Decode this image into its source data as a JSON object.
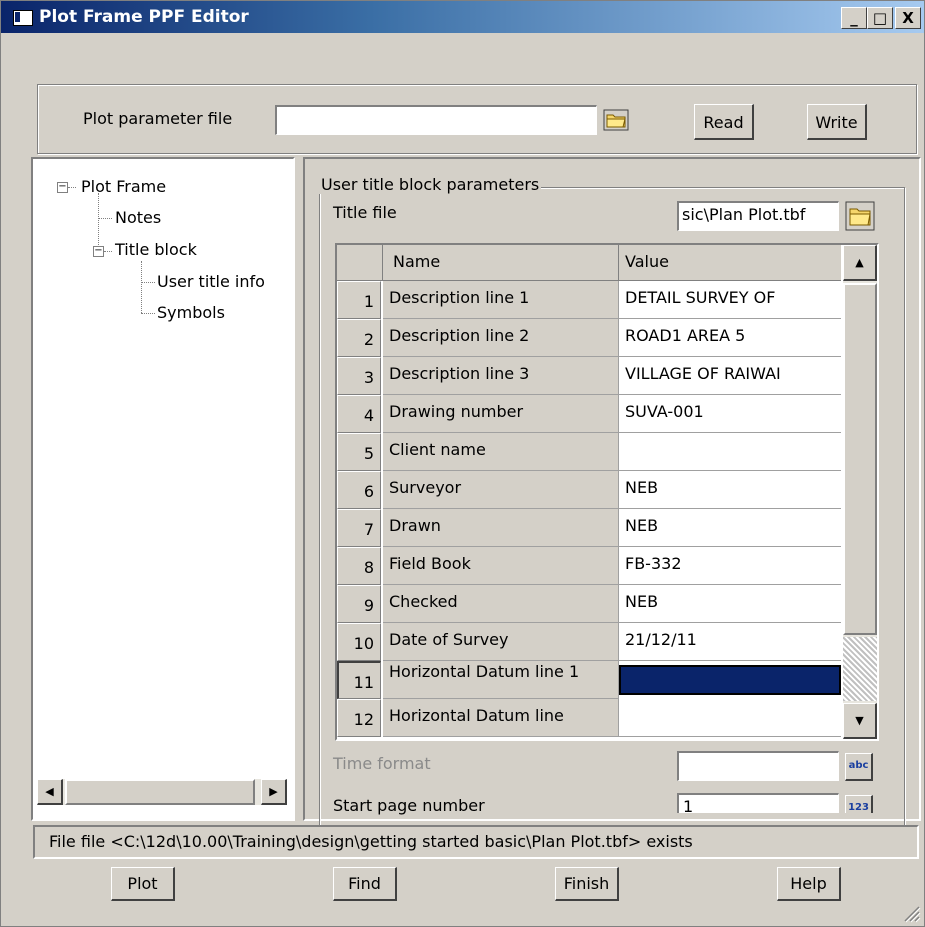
{
  "window": {
    "title": "Plot Frame PPF Editor",
    "controls": {
      "minimize": "_",
      "maximize": "□",
      "close": "X"
    }
  },
  "top": {
    "ppf_label": "Plot parameter file",
    "ppf_value": "",
    "read_label": "Read",
    "write_label": "Write"
  },
  "tree": {
    "items": [
      {
        "label": "Plot Frame",
        "expander": "−"
      },
      {
        "label": "Notes"
      },
      {
        "label": "Title block",
        "expander": "−"
      },
      {
        "label": "User title info"
      },
      {
        "label": "Symbols"
      }
    ]
  },
  "panel": {
    "group_label": "User title block parameters",
    "title_file_label": "Title file",
    "title_file_value": "sic\\Plan Plot.tbf",
    "grid": {
      "headers": [
        "Name",
        "Value"
      ],
      "rows": [
        {
          "num": "1",
          "name": "Description line 1",
          "value": "DETAIL SURVEY OF"
        },
        {
          "num": "2",
          "name": "Description line 2",
          "value": "ROAD1 AREA 5"
        },
        {
          "num": "3",
          "name": "Description line 3",
          "value": "VILLAGE OF RAIWAI"
        },
        {
          "num": "4",
          "name": "Drawing number",
          "value": "SUVA-001"
        },
        {
          "num": "5",
          "name": "Client name",
          "value": ""
        },
        {
          "num": "6",
          "name": "Surveyor",
          "value": "NEB"
        },
        {
          "num": "7",
          "name": "Drawn",
          "value": "NEB"
        },
        {
          "num": "8",
          "name": "Field Book",
          "value": "FB-332"
        },
        {
          "num": "9",
          "name": "Checked",
          "value": "NEB"
        },
        {
          "num": "10",
          "name": "Date of Survey",
          "value": "21/12/11"
        },
        {
          "num": "11",
          "name": "Horizontal Datum line 1",
          "value": ""
        },
        {
          "num": "12",
          "name": "Horizontal Datum line",
          "value": ""
        }
      ],
      "selected_color": "#0a246a"
    },
    "time_format_label": "Time format",
    "time_format_value": "",
    "time_format_icon_text": "abc",
    "start_page_label": "Start page number",
    "start_page_value": "1",
    "start_page_icon_text": "123"
  },
  "status": {
    "message": "File file <C:\\12d\\10.00\\Training\\design\\getting started basic\\Plan Plot.tbf> exists"
  },
  "buttons": {
    "plot": "Plot",
    "find": "Find",
    "finish": "Finish",
    "help": "Help"
  }
}
